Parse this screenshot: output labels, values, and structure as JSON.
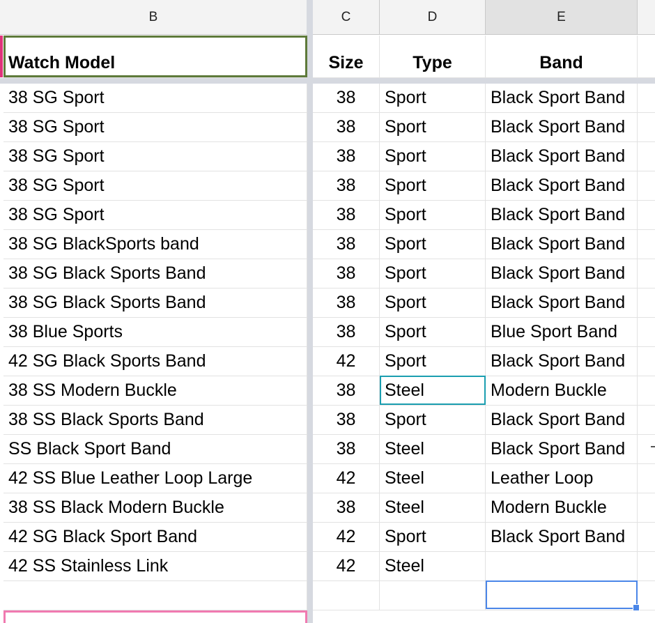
{
  "column_headers": [
    "B",
    "C",
    "D",
    "E"
  ],
  "header_row": {
    "watch_model": "Watch Model",
    "size": "Size",
    "type": "Type",
    "band": "Band"
  },
  "rows": [
    {
      "model": "38 SG Sport",
      "size": "38",
      "type": "Sport",
      "band": "Black Sport Band"
    },
    {
      "model": "38 SG Sport",
      "size": "38",
      "type": "Sport",
      "band": "Black Sport Band"
    },
    {
      "model": "38 SG Sport",
      "size": "38",
      "type": "Sport",
      "band": "Black Sport Band"
    },
    {
      "model": "38 SG Sport",
      "size": "38",
      "type": "Sport",
      "band": "Black Sport Band"
    },
    {
      "model": "38 SG Sport",
      "size": "38",
      "type": "Sport",
      "band": "Black Sport Band"
    },
    {
      "model": "38 SG BlackSports band",
      "size": "38",
      "type": "Sport",
      "band": "Black Sport Band"
    },
    {
      "model": "38 SG Black Sports Band",
      "size": "38",
      "type": "Sport",
      "band": "Black Sport Band"
    },
    {
      "model": "38 SG Black Sports Band",
      "size": "38",
      "type": "Sport",
      "band": "Black Sport Band"
    },
    {
      "model": "38 Blue Sports",
      "size": "38",
      "type": "Sport",
      "band": "Blue Sport Band"
    },
    {
      "model": "42 SG Black Sports Band",
      "size": "42",
      "type": "Sport",
      "band": "Black Sport Band"
    },
    {
      "model": "38 SS Modern Buckle",
      "size": "38",
      "type": "Steel",
      "band": "Modern Buckle"
    },
    {
      "model": "38 SS Black Sports Band",
      "size": "38",
      "type": "Sport",
      "band": "Black Sport Band"
    },
    {
      "model": "SS Black Sport Band",
      "size": "38",
      "type": "Steel",
      "band": "Black Sport Band"
    },
    {
      "model": "42 SS Blue Leather Loop Large",
      "size": "42",
      "type": "Steel",
      "band": "Leather Loop"
    },
    {
      "model": "38 SS Black Modern Buckle",
      "size": "38",
      "type": "Steel",
      "band": "Modern Buckle"
    },
    {
      "model": "42 SG Black Sport Band",
      "size": "42",
      "type": "Sport",
      "band": "Black Sport Band"
    },
    {
      "model": "42 SS Stainless Link",
      "size": "42",
      "type": "Steel",
      "band": ""
    },
    {
      "model": "",
      "size": "",
      "type": "",
      "band": ""
    }
  ],
  "colors": {
    "selection_header": "#5e7a3a",
    "selection_active": "#1a9eb0",
    "selection_blue": "#4a86e8",
    "highlight_pink": "#f07ab0"
  }
}
